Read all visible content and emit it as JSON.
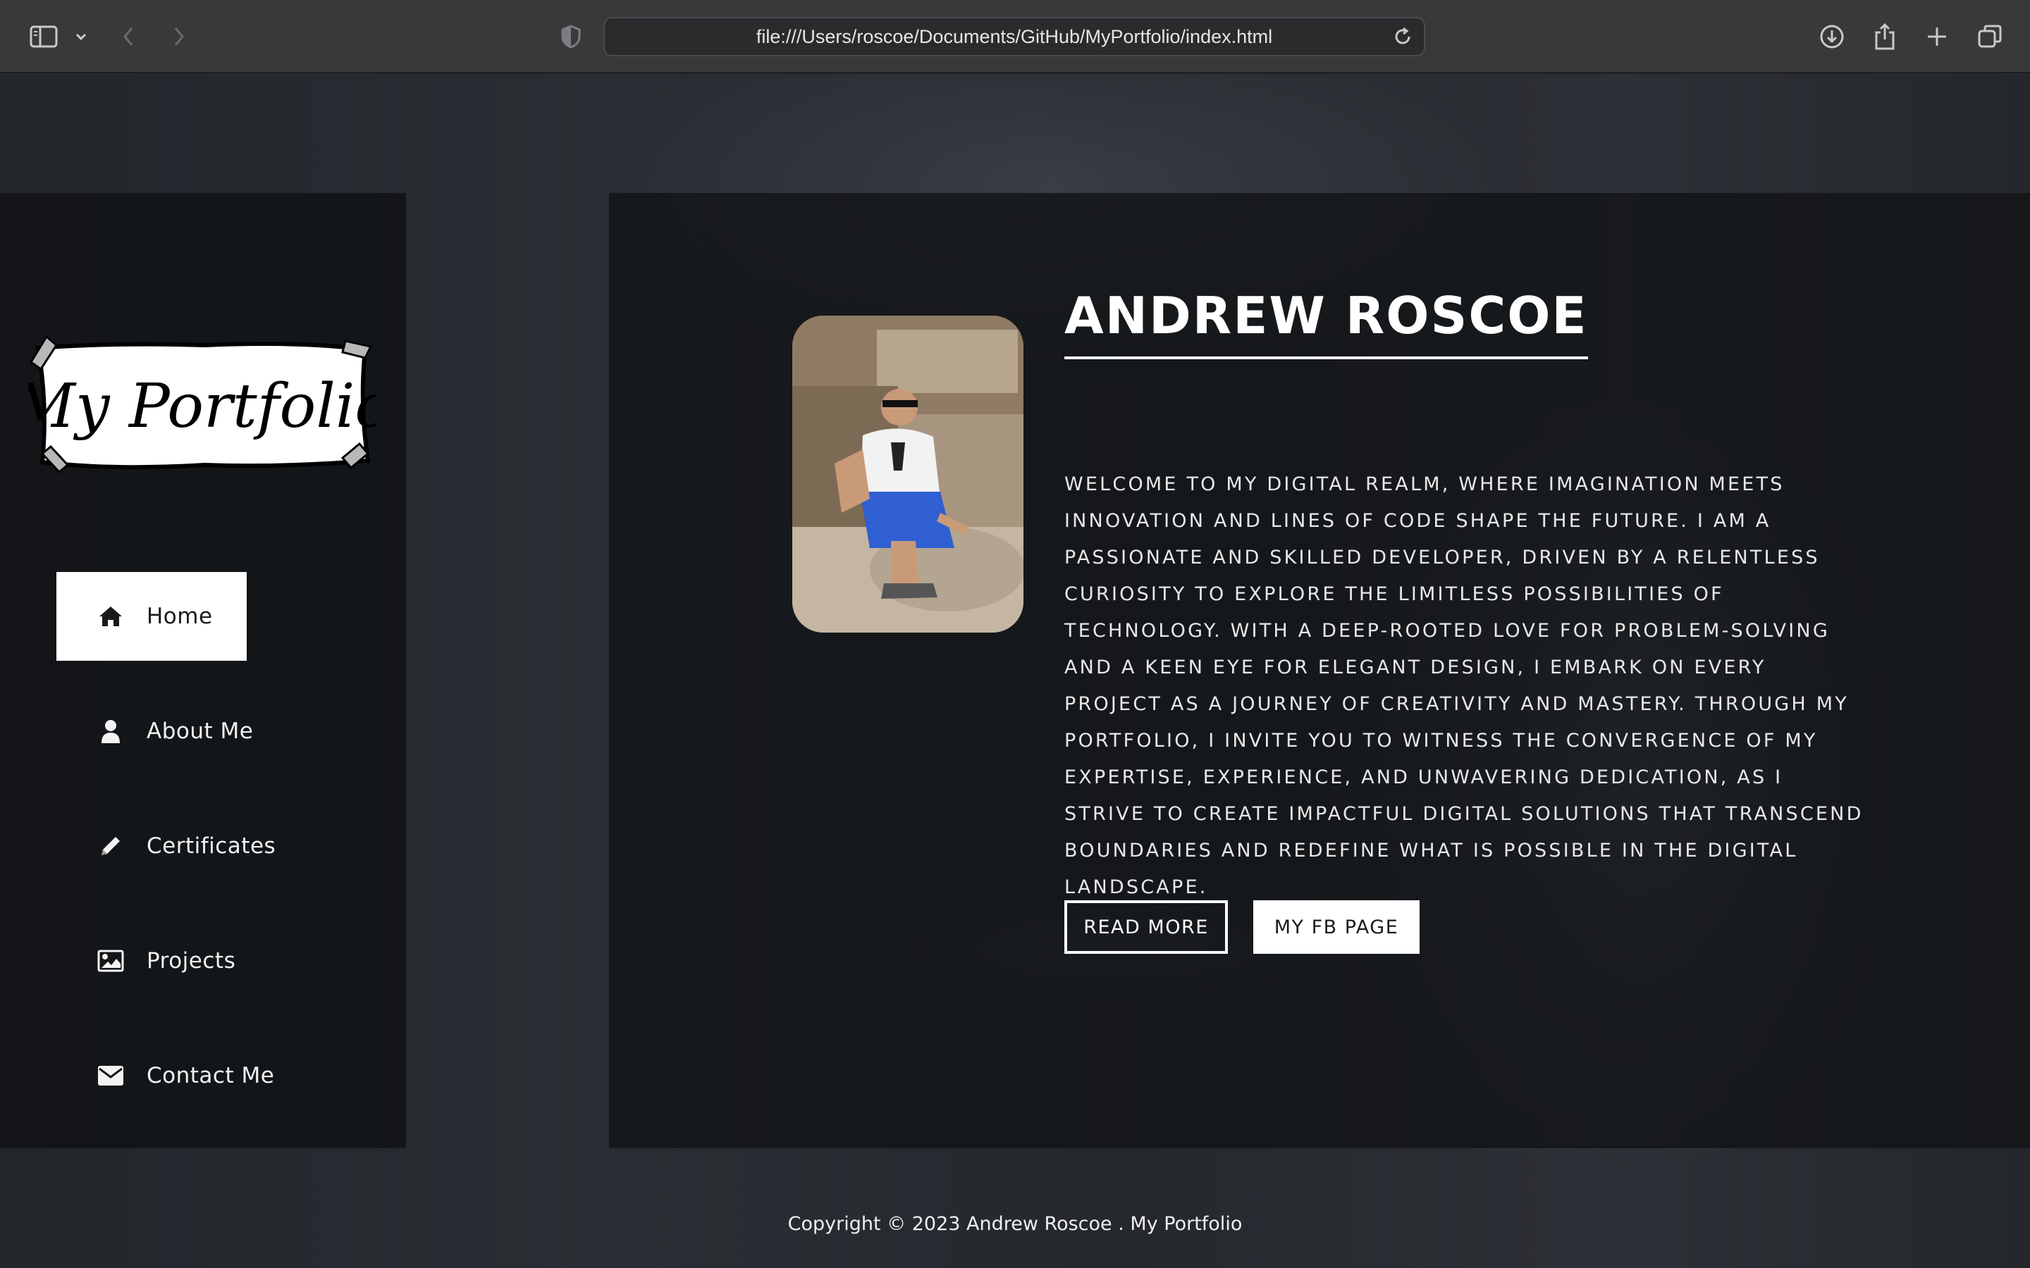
{
  "browser": {
    "url": "file:///Users/roscoe/Documents/GitHub/MyPortfolio/index.html"
  },
  "logo": {
    "text": "My Portfolio"
  },
  "nav": {
    "items": [
      {
        "label": "Home",
        "icon": "home-icon",
        "active": true
      },
      {
        "label": "About Me",
        "icon": "user-icon",
        "active": false
      },
      {
        "label": "Certificates",
        "icon": "pencil-icon",
        "active": false
      },
      {
        "label": "Projects",
        "icon": "image-icon",
        "active": false
      },
      {
        "label": "Contact Me",
        "icon": "envelope-icon",
        "active": false
      }
    ]
  },
  "hero": {
    "name": "ANDREW ROSCOE",
    "bio": "WELCOME TO MY DIGITAL REALM, WHERE IMAGINATION MEETS INNOVATION AND LINES OF CODE SHAPE THE FUTURE. I AM A PASSIONATE AND SKILLED DEVELOPER, DRIVEN BY A RELENTLESS CURIOSITY TO EXPLORE THE LIMITLESS POSSIBILITIES OF TECHNOLOGY. WITH A DEEP-ROOTED LOVE FOR PROBLEM-SOLVING AND A KEEN EYE FOR ELEGANT DESIGN, I EMBARK ON EVERY PROJECT AS A JOURNEY OF CREATIVITY AND MASTERY. THROUGH MY PORTFOLIO, I INVITE YOU TO WITNESS THE CONVERGENCE OF MY EXPERTISE, EXPERIENCE, AND UNWAVERING DEDICATION, AS I STRIVE TO CREATE IMPACTFUL DIGITAL SOLUTIONS THAT TRANSCEND BOUNDARIES AND REDEFINE WHAT IS POSSIBLE IN THE DIGITAL LANDSCAPE.",
    "read_more_label": "READ MORE",
    "fb_label": "MY FB PAGE"
  },
  "footer": {
    "text": "Copyright © 2023 Andrew Roscoe . My Portfolio"
  },
  "colors": {
    "chrome_bg": "#37393b",
    "panel_bg": "#111316",
    "accent": "#ffffff"
  }
}
